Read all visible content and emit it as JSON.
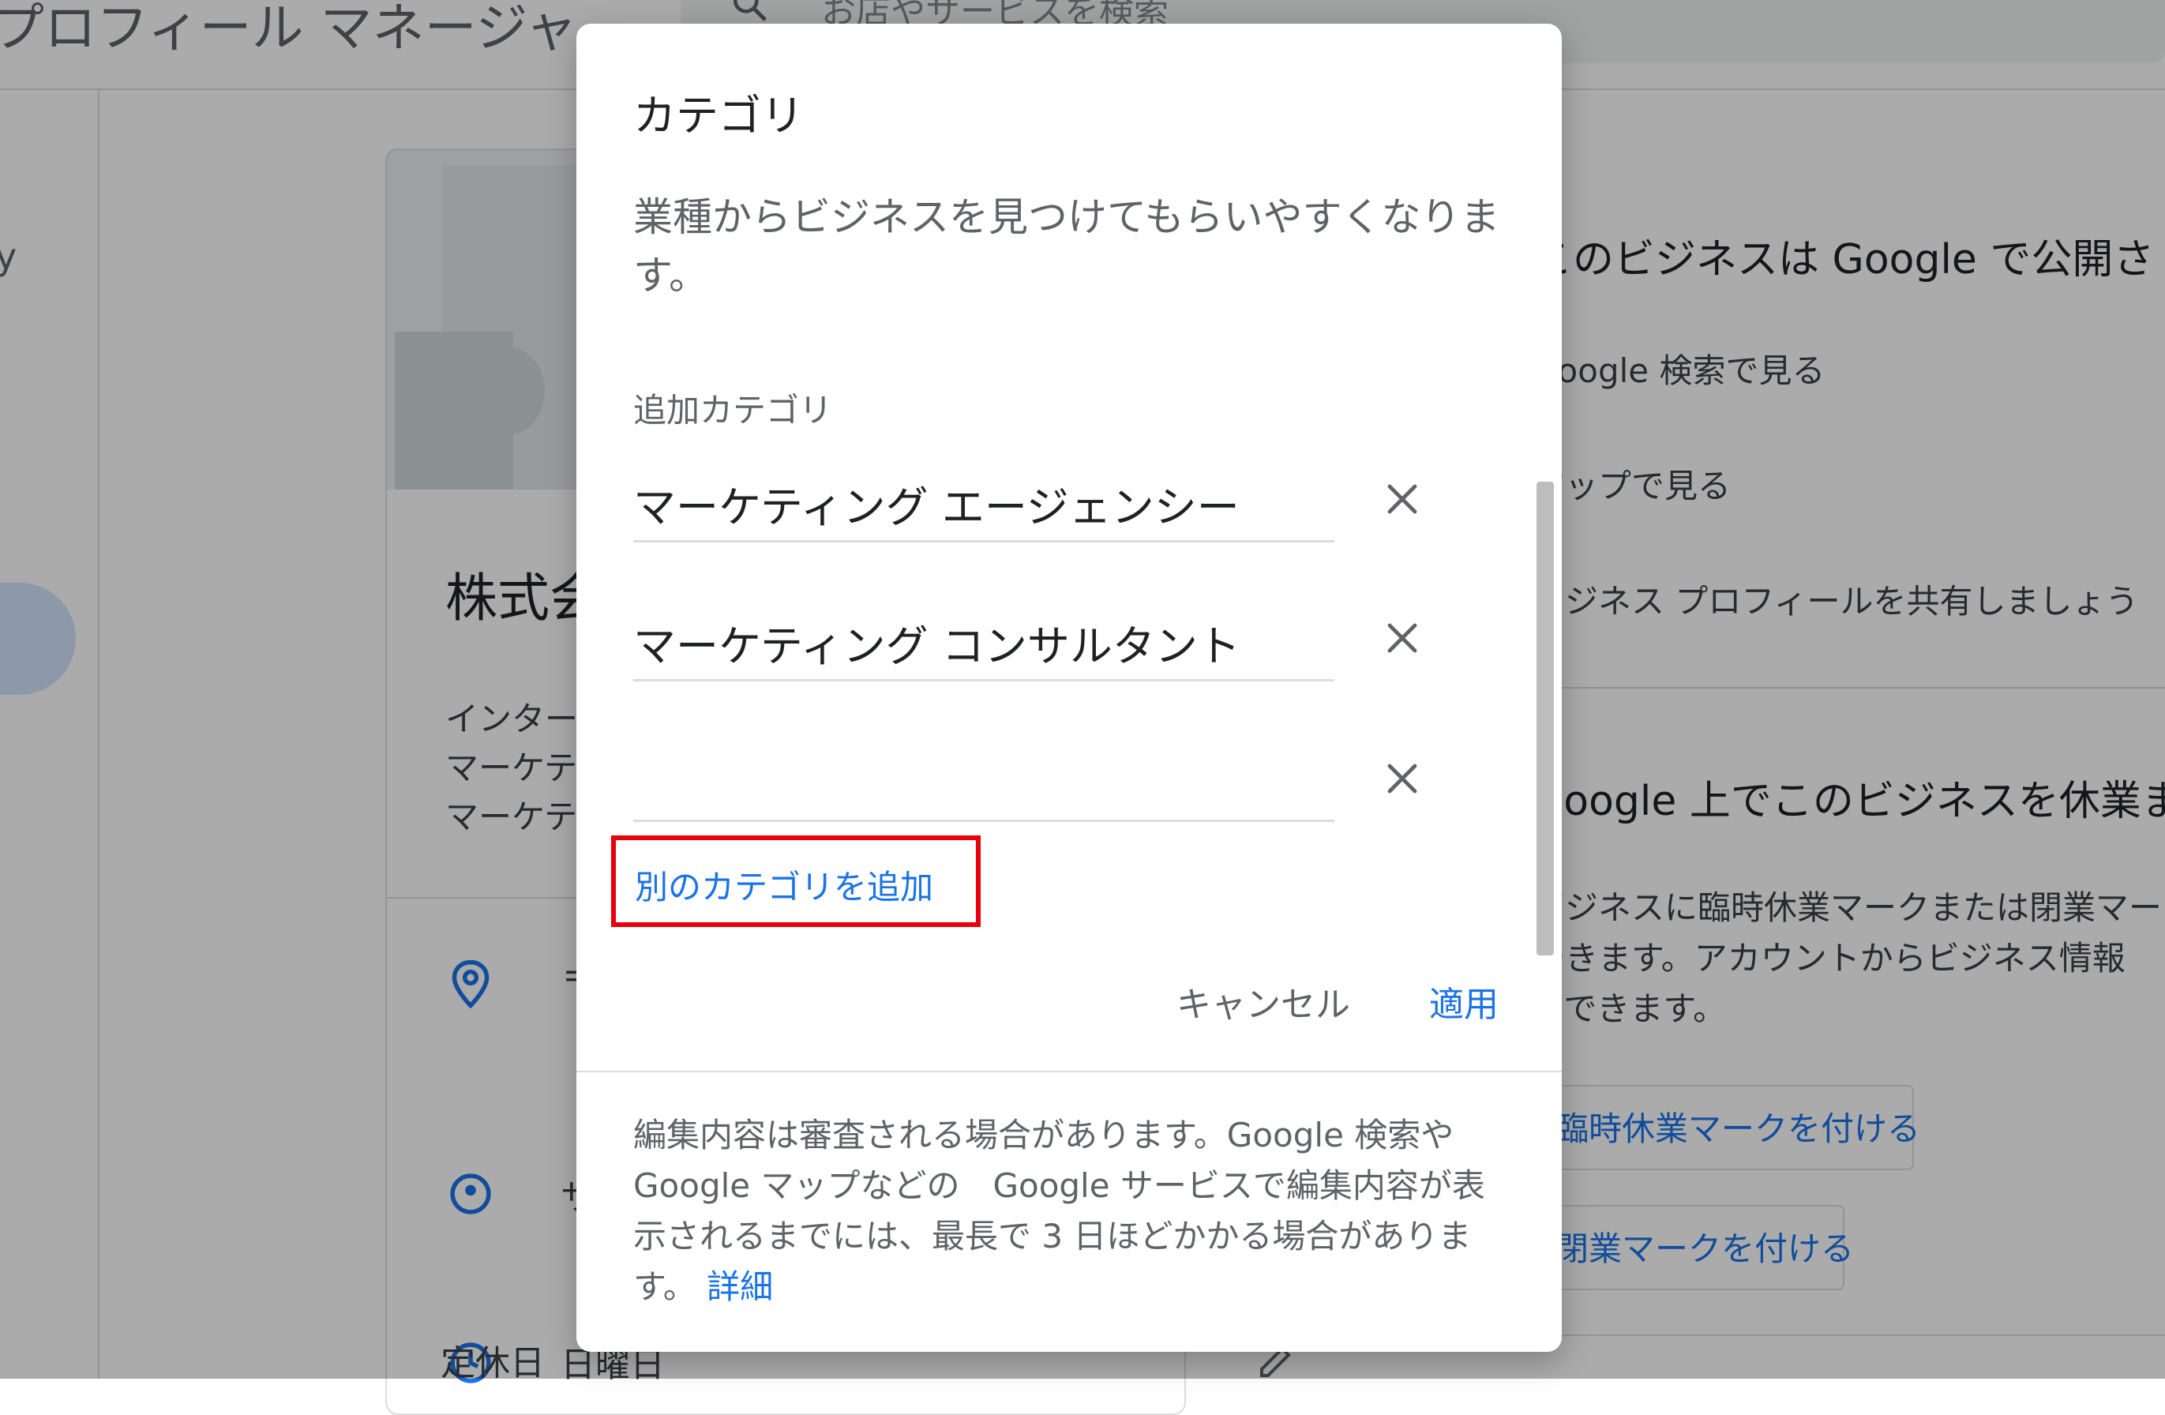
{
  "background": {
    "app_title": "プロフィール マネージャ",
    "search_placeholder": "お店やサービスを検索",
    "nav_letter": "y",
    "business": {
      "name": "株式会",
      "categories": [
        "インター",
        "マーケテ",
        "マーケテ"
      ]
    },
    "rows": [
      {
        "icon": "location-pin-icon",
        "text": "〒"
      },
      {
        "icon": "service-area-icon",
        "text": "サ"
      },
      {
        "icon": "clock-icon",
        "text": "日曜日",
        "value": "定休日"
      }
    ],
    "right_panel": {
      "published_title": "このビジネスは Google で公開さ",
      "links": [
        "Google 検索で見る",
        "マップで見る",
        "ビジネス プロフィールを共有しましょう"
      ],
      "closure_title": "Google 上でこのビジネスを休業または",
      "closure_desc": [
        "ビジネスに臨時休業マークまたは閉業マーク",
        "できます。アカウントからビジネス情報",
        "もできます。"
      ],
      "buttons": [
        "臨時休業マークを付ける",
        "閉業マークを付ける"
      ]
    }
  },
  "dialog": {
    "title": "カテゴリ",
    "description_line1": "業種からビジネスを見つけてもらいやすくなりま",
    "description_line2": "す。",
    "additional_label": "追加カテゴリ",
    "categories": [
      {
        "value": "マーケティング エージェンシー"
      },
      {
        "value": "マーケティング コンサルタント"
      },
      {
        "value": ""
      }
    ],
    "add_category": "別のカテゴリを追加",
    "cancel": "キャンセル",
    "apply": "適用",
    "footer": {
      "line1": "編集内容は審査される場合があります。Google 検索や",
      "line2": "Google マップなどの　Google サービスで編集内容が表",
      "line3": "示されるまでには、最長で 3 日ほどかかる場合がありま",
      "line4": "す。",
      "link": "詳細"
    }
  },
  "colors": {
    "accent": "#1a73e8",
    "highlight_border": "#e8000b",
    "scrim": "rgba(0,0,0,0.33)"
  }
}
